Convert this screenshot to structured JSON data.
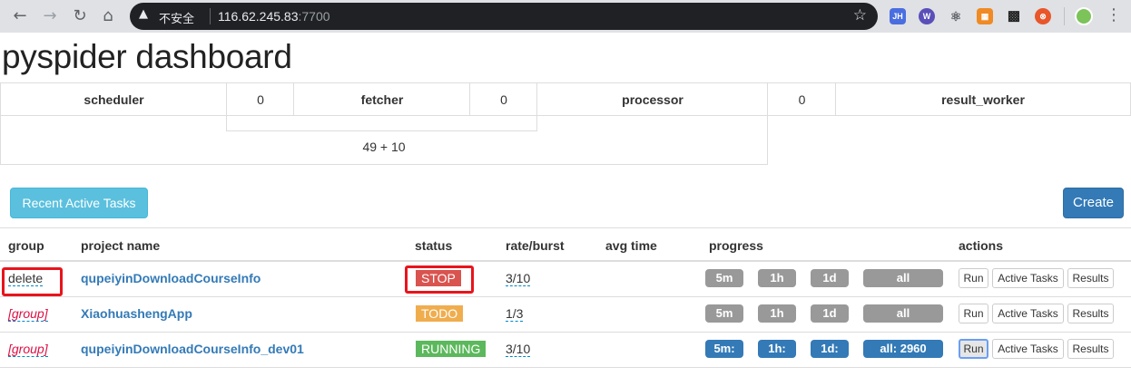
{
  "browser": {
    "insecure_label": "不安全",
    "host": "116.62.245.83",
    "port": ":7700",
    "extensions": [
      "JH",
      "W",
      "⚛",
      "▦",
      "▩",
      "⊗"
    ]
  },
  "page": {
    "title": "pyspider dashboard"
  },
  "stats": {
    "scheduler_label": "scheduler",
    "scheduler_value": "0",
    "fetcher_label": "fetcher",
    "fetcher_value": "0",
    "processor_label": "processor",
    "processor_value": "0",
    "result_worker_label": "result_worker",
    "queue_value": "49 + 10"
  },
  "toolbar": {
    "recent_label": "Recent Active Tasks",
    "create_label": "Create"
  },
  "table": {
    "headers": {
      "group": "group",
      "project_name": "project name",
      "status": "status",
      "rate_burst": "rate/burst",
      "avg_time": "avg time",
      "progress": "progress",
      "actions": "actions"
    },
    "rows": [
      {
        "group": "delete",
        "name": "qupeiyinDownloadCourseInfo",
        "status": "STOP",
        "rate": "3/10",
        "progress": [
          "5m",
          "1h",
          "1d",
          "all"
        ],
        "actions": [
          "Run",
          "Active Tasks",
          "Results"
        ]
      },
      {
        "group": "[group]",
        "name": "XiaohuashengApp",
        "status": "TODO",
        "rate": "1/3",
        "progress": [
          "5m",
          "1h",
          "1d",
          "all"
        ],
        "actions": [
          "Run",
          "Active Tasks",
          "Results"
        ]
      },
      {
        "group": "[group]",
        "name": "qupeiyinDownloadCourseInfo_dev01",
        "status": "RUNNING",
        "rate": "3/10",
        "progress": [
          "5m:",
          "1h:",
          "1d:",
          "all: 2960"
        ],
        "actions": [
          "Run",
          "Active Tasks",
          "Results"
        ]
      }
    ]
  },
  "colors": {
    "stop": "#d9534f",
    "todo": "#f0ad4e",
    "running": "#5cb85c",
    "primary": "#337ab7",
    "info": "#5bc0de",
    "highlight": "#e8141c"
  }
}
